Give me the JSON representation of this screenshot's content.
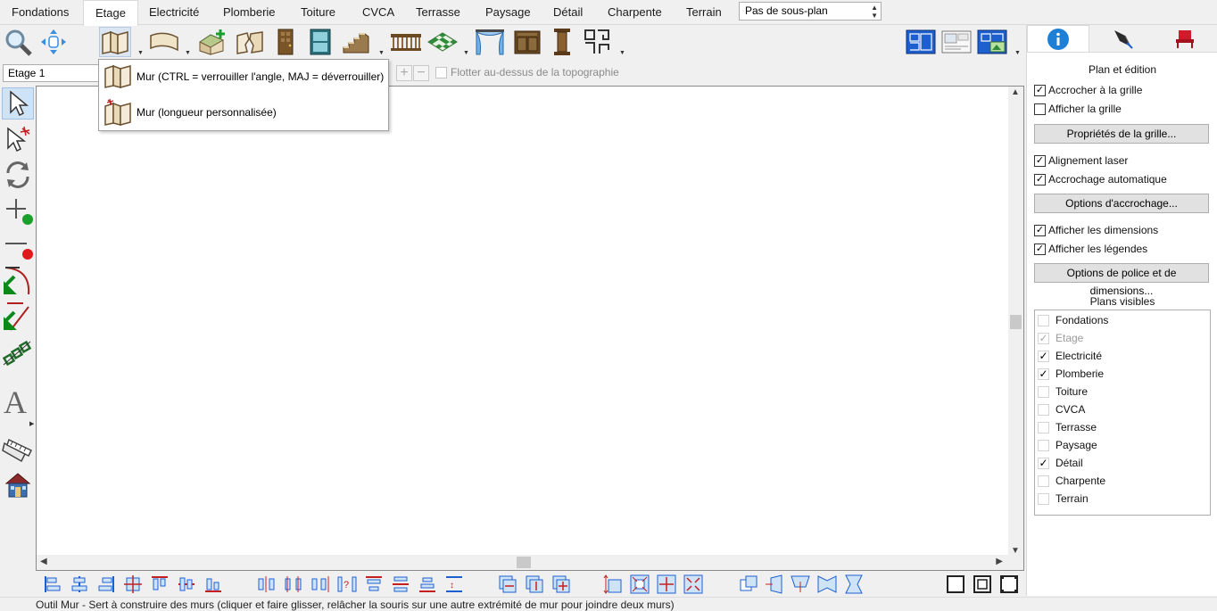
{
  "tabs": [
    {
      "label": "Fondations",
      "active": false
    },
    {
      "label": "Etage",
      "active": true
    },
    {
      "label": "Electricité",
      "active": false
    },
    {
      "label": "Plomberie",
      "active": false
    },
    {
      "label": "Toiture",
      "active": false
    },
    {
      "label": "CVCA",
      "active": false
    },
    {
      "label": "Terrasse",
      "active": false
    },
    {
      "label": "Paysage",
      "active": false
    },
    {
      "label": "Détail",
      "active": false
    },
    {
      "label": "Charpente",
      "active": false
    },
    {
      "label": "Terrain",
      "active": false
    }
  ],
  "subplan": {
    "value": "Pas de sous-plan"
  },
  "floor": {
    "value": "Etage 1"
  },
  "float_topo": {
    "label": "Flotter au-dessus de la topographie",
    "checked": false
  },
  "wall_menu": {
    "items": [
      {
        "label": "Mur (CTRL = verrouiller l'angle, MAJ = déverrouiller)"
      },
      {
        "label": "Mur (longueur personnalisée)"
      }
    ]
  },
  "status_bar": {
    "text": "Outil Mur - Sert à construire des murs (cliquer et faire glisser, relâcher la souris sur une autre extrémité de mur pour joindre deux murs)"
  },
  "right_panel": {
    "tabs": [
      {
        "icon": "info-icon",
        "active": true
      },
      {
        "icon": "pen-icon",
        "active": false
      },
      {
        "icon": "chair-icon",
        "active": false
      }
    ],
    "title": "Plan et édition",
    "snap_grid": {
      "label": "Accrocher à la grille",
      "checked": true
    },
    "show_grid": {
      "label": "Afficher la grille",
      "checked": false
    },
    "grid_props_button": "Propriétés de la grille...",
    "laser": {
      "label": "Alignement laser",
      "checked": true
    },
    "auto_snap": {
      "label": "Accrochage automatique",
      "checked": true
    },
    "snap_options_button": "Options d'accrochage...",
    "show_dims": {
      "label": "Afficher les dimensions",
      "checked": true
    },
    "show_captions": {
      "label": "Afficher les légendes",
      "checked": true
    },
    "font_dims_button": "Options de police et de dimensions...",
    "visible_plans_title": "Plans visibles",
    "visible_plans": [
      {
        "label": "Fondations",
        "checked": false,
        "disabled": false
      },
      {
        "label": "Etage",
        "checked": true,
        "disabled": true
      },
      {
        "label": "Electricité",
        "checked": true,
        "disabled": false
      },
      {
        "label": "Plomberie",
        "checked": true,
        "disabled": false
      },
      {
        "label": "Toiture",
        "checked": false,
        "disabled": false
      },
      {
        "label": "CVCA",
        "checked": false,
        "disabled": false
      },
      {
        "label": "Terrasse",
        "checked": false,
        "disabled": false
      },
      {
        "label": "Paysage",
        "checked": false,
        "disabled": false
      },
      {
        "label": "Détail",
        "checked": true,
        "disabled": false
      },
      {
        "label": "Charpente",
        "checked": false,
        "disabled": false
      },
      {
        "label": "Terrain",
        "checked": false,
        "disabled": false
      }
    ]
  },
  "colors": {
    "accent": "#1e7fd6",
    "selection": "#cfe3f7",
    "wood": "#8b6a3e"
  }
}
